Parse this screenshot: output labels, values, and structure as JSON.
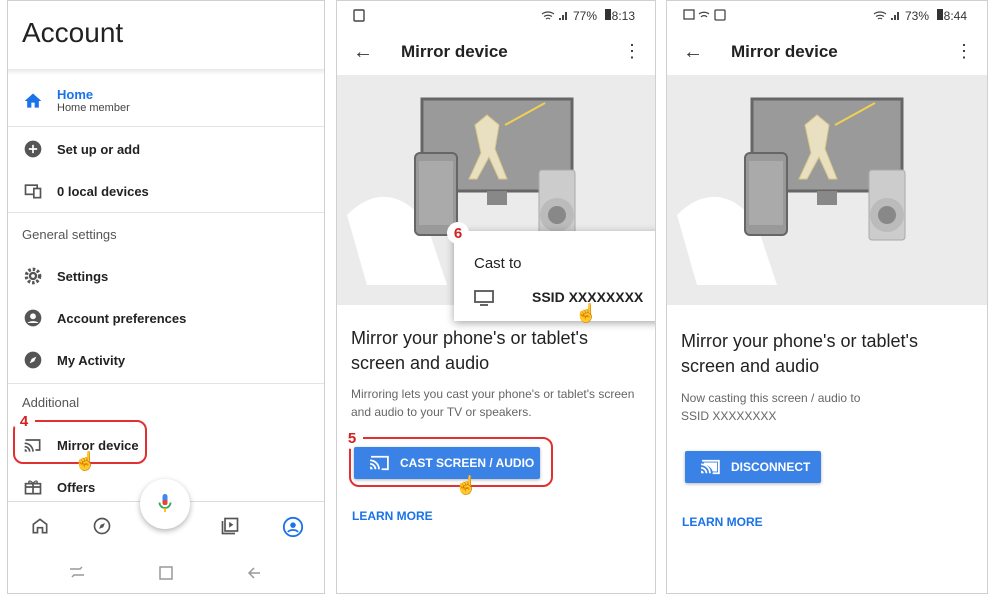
{
  "panel1": {
    "title": "Account",
    "menu": [
      {
        "name": "home",
        "label": "Home",
        "sublabel": "Home member"
      },
      {
        "name": "set-up-or-add",
        "label": "Set up or add"
      },
      {
        "name": "local-devices",
        "label": "0 local devices"
      }
    ],
    "sections": {
      "general": "General settings",
      "additional": "Additional"
    },
    "general_items": [
      {
        "label": "Settings"
      },
      {
        "label": "Account preferences"
      },
      {
        "label": "My Activity"
      }
    ],
    "additional_items": [
      {
        "label": "Mirror device"
      },
      {
        "label": "Offers"
      }
    ],
    "step_badge": "4"
  },
  "panel2": {
    "status": {
      "battery": "77%",
      "time": "18:13"
    },
    "appbar_title": "Mirror device",
    "heading": "Mirror your phone's or tablet's screen and audio",
    "description": "Mirroring lets you cast your phone's or tablet's screen and audio to your TV or speakers.",
    "cast_button": "CAST SCREEN / AUDIO",
    "learn_more": "LEARN MORE",
    "step_badge_cast": "5",
    "step_badge_popup": "6",
    "popup": {
      "title": "Cast to",
      "device": "SSID XXXXXXXX"
    }
  },
  "panel3": {
    "status": {
      "battery": "73%",
      "time": "18:44"
    },
    "appbar_title": "Mirror device",
    "heading": "Mirror your phone's or tablet's screen and audio",
    "description": "Now casting this screen / audio to SSID XXXXXXXX",
    "disconnect_button": "DISCONNECT",
    "learn_more": "LEARN MORE"
  },
  "colors": {
    "accent": "#1a73e8",
    "button": "#3b82e6",
    "callout": "#e03030",
    "hero_bg": "#ebebeb"
  }
}
